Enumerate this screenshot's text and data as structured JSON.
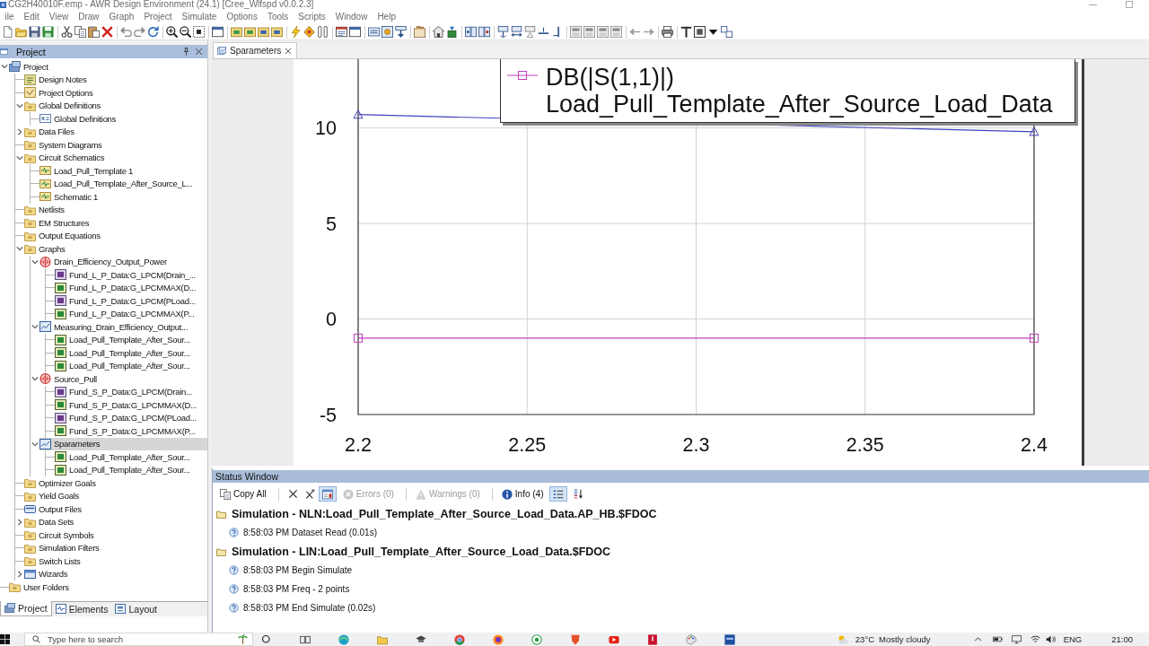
{
  "title_bar": {
    "title": "CG2H40010F.emp - AWR Design Environment (24.1) [Cree_Wlfspd v0.0.2.3]"
  },
  "menu": [
    "ile",
    "Edit",
    "View",
    "Draw",
    "Graph",
    "Project",
    "Simulate",
    "Options",
    "Tools",
    "Scripts",
    "Window",
    "Help"
  ],
  "project_panel": {
    "title": "Project",
    "tree": [
      {
        "label": "Project",
        "kind": "project",
        "selected": false,
        "expanded": true,
        "children": [
          {
            "label": "Design Notes",
            "kind": "notes",
            "selected": false
          },
          {
            "label": "Project Options",
            "kind": "options",
            "selected": false
          },
          {
            "label": "Global Definitions",
            "kind": "folder",
            "selected": false,
            "expanded": true,
            "children": [
              {
                "label": "Global Definitions",
                "kind": "equations",
                "selected": false
              }
            ]
          },
          {
            "label": "Data Files",
            "kind": "folder",
            "selected": false,
            "expanded": false
          },
          {
            "label": "System Diagrams",
            "kind": "folder",
            "selected": false
          },
          {
            "label": "Circuit Schematics",
            "kind": "folder",
            "selected": false,
            "expanded": true,
            "children": [
              {
                "label": "Load_Pull_Template 1",
                "kind": "schematic",
                "selected": false
              },
              {
                "label": "Load_Pull_Template_After_Source_L...",
                "kind": "schematic",
                "selected": false
              },
              {
                "label": "Schematic 1",
                "kind": "schematic",
                "selected": false
              }
            ]
          },
          {
            "label": "Netlists",
            "kind": "folder",
            "selected": false
          },
          {
            "label": "EM Structures",
            "kind": "folder",
            "selected": false
          },
          {
            "label": "Output Equations",
            "kind": "folder",
            "selected": false
          },
          {
            "label": "Graphs",
            "kind": "folder",
            "selected": false,
            "expanded": true,
            "children": [
              {
                "label": "Drain_Efficiency_Output_Power",
                "kind": "polar",
                "selected": false,
                "expanded": true,
                "children": [
                  {
                    "label": "Fund_L_P_Data:G_LPCM(Drain_...",
                    "kind": "contour",
                    "selected": false
                  },
                  {
                    "label": "Fund_L_P_Data:G_LPCMMAX(D...",
                    "kind": "marker",
                    "selected": false
                  },
                  {
                    "label": "Fund_L_P_Data:G_LPCM(PLoad...",
                    "kind": "contour",
                    "selected": false
                  },
                  {
                    "label": "Fund_L_P_Data:G_LPCMMAX(P...",
                    "kind": "marker",
                    "selected": false
                  }
                ]
              },
              {
                "label": "Measuring_Drain_Efficiency_Output...",
                "kind": "rect",
                "selected": false,
                "expanded": true,
                "children": [
                  {
                    "label": "Load_Pull_Template_After_Sour...",
                    "kind": "marker",
                    "selected": false
                  },
                  {
                    "label": "Load_Pull_Template_After_Sour...",
                    "kind": "marker",
                    "selected": false
                  },
                  {
                    "label": "Load_Pull_Template_After_Sour...",
                    "kind": "marker",
                    "selected": false
                  }
                ]
              },
              {
                "label": "Source_Pull",
                "kind": "polar",
                "selected": false,
                "expanded": true,
                "children": [
                  {
                    "label": "Fund_S_P_Data:G_LPCM(Drain...",
                    "kind": "contour",
                    "selected": false
                  },
                  {
                    "label": "Fund_S_P_Data:G_LPCMMAX(D...",
                    "kind": "marker",
                    "selected": false
                  },
                  {
                    "label": "Fund_S_P_Data:G_LPCM(PLoad...",
                    "kind": "contour",
                    "selected": false
                  },
                  {
                    "label": "Fund_S_P_Data:G_LPCMMAX(P...",
                    "kind": "marker",
                    "selected": false
                  }
                ]
              },
              {
                "label": "Sparameters",
                "kind": "rect",
                "selected": true,
                "expanded": true,
                "children": [
                  {
                    "label": "Load_Pull_Template_After_Sour...",
                    "kind": "marker",
                    "selected": false
                  },
                  {
                    "label": "Load_Pull_Template_After_Sour...",
                    "kind": "marker",
                    "selected": false
                  }
                ]
              }
            ]
          },
          {
            "label": "Optimizer Goals",
            "kind": "folder",
            "selected": false
          },
          {
            "label": "Yield Goals",
            "kind": "folder",
            "selected": false
          },
          {
            "label": "Output Files",
            "kind": "files",
            "selected": false
          },
          {
            "label": "Data Sets",
            "kind": "folder",
            "selected": false,
            "expanded": false
          },
          {
            "label": "Circuit Symbols",
            "kind": "folder",
            "selected": false
          },
          {
            "label": "Simulation Filters",
            "kind": "folder",
            "selected": false
          },
          {
            "label": "Switch Lists",
            "kind": "folder",
            "selected": false
          },
          {
            "label": "Wizards",
            "kind": "wizard",
            "selected": false,
            "expanded": false
          }
        ]
      },
      {
        "label": "User Folders",
        "kind": "folder",
        "selected": false
      }
    ],
    "tabs": [
      {
        "label": "Project",
        "kind": "project",
        "selected": true
      },
      {
        "label": "Elements",
        "kind": "elements",
        "selected": false
      },
      {
        "label": "Layout",
        "kind": "layout",
        "selected": false
      }
    ]
  },
  "document_tabs": [
    {
      "label": "Sparameters",
      "selected": true
    }
  ],
  "graph": {
    "legend": {
      "source": "Load_Pull_Template_After_Source_Load_Data"
    },
    "chart_data": {
      "type": "line",
      "x": [
        2.2,
        2.4
      ],
      "series": [
        {
          "name": "DB(|S(1,1)|)",
          "color": "#bf40bf",
          "marker": "square",
          "values": [
            -1,
            -1
          ]
        },
        {
          "color": "#4040c0",
          "marker": "triangle",
          "values": [
            10.7,
            9.8
          ]
        }
      ],
      "xlim": [
        2.2,
        2.4
      ],
      "ylim": [
        -5,
        13.6
      ],
      "xticks": [
        2.2,
        2.25,
        2.3,
        2.35,
        2.4
      ],
      "yticks": [
        -5,
        0,
        5,
        10
      ],
      "grid": true
    }
  },
  "status_window": {
    "title": "Status Window",
    "tools": [
      {
        "kind": "copy",
        "label": "Copy All"
      },
      {
        "kind": "clear"
      },
      {
        "kind": "clearall"
      },
      {
        "kind": "details",
        "on": true
      },
      {
        "kind": "errors",
        "label": "Errors (0)",
        "disabled": true
      },
      {
        "kind": "warnings",
        "label": "Warnings (0)",
        "disabled": true
      },
      {
        "kind": "info",
        "label": "Info (4)",
        "disabled": false
      },
      {
        "kind": "group",
        "on": true
      },
      {
        "kind": "sort"
      }
    ],
    "groups": [
      {
        "title": "Simulation - NLN:Load_Pull_Template_After_Source_Load_Data.AP_HB.$FDOC",
        "messages": [
          "8:58:03 PM Dataset Read (0.01s)"
        ]
      },
      {
        "title": "Simulation - LIN:Load_Pull_Template_After_Source_Load_Data.$FDOC",
        "messages": [
          "8:58:03 PM Begin Simulate",
          "8:58:03 PM Freq - 2 points",
          "8:58:03 PM End Simulate (0.02s)"
        ]
      }
    ]
  },
  "taskbar": {
    "search": {
      "placeholder": "Type here to search"
    },
    "weather": {
      "temperature": "23°C",
      "condition": "Mostly cloudy"
    },
    "language": "ENG",
    "clock": "21:00"
  }
}
